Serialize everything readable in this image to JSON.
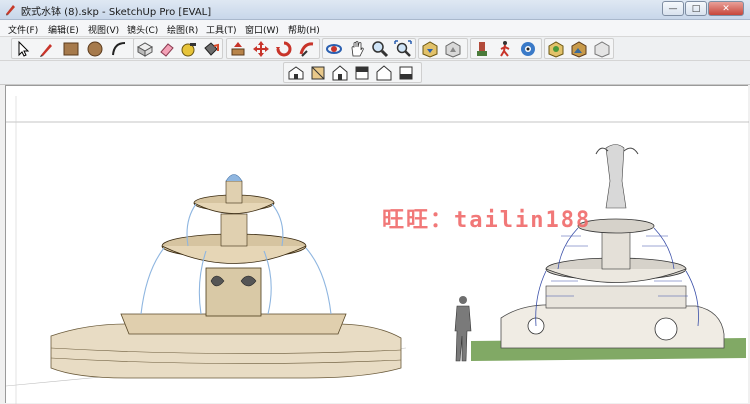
{
  "window": {
    "title": "欧式水钵 (8).skp - SketchUp Pro [EVAL]",
    "buttons": {
      "minimize": "—",
      "maximize": "□",
      "close": "✕"
    }
  },
  "menu": [
    {
      "label": "文件(F)"
    },
    {
      "label": "编辑(E)"
    },
    {
      "label": "视图(V)"
    },
    {
      "label": "镜头(C)"
    },
    {
      "label": "绘图(R)"
    },
    {
      "label": "工具(T)"
    },
    {
      "label": "窗口(W)"
    },
    {
      "label": "帮助(H)"
    }
  ],
  "toolbar_main": [
    {
      "name": "select-icon"
    },
    {
      "name": "pencil-icon"
    },
    {
      "name": "rectangle-icon"
    },
    {
      "name": "circle-icon"
    },
    {
      "name": "arc-icon"
    },
    {
      "name": "make-component-icon"
    },
    {
      "name": "eraser-icon"
    },
    {
      "name": "tape-measure-icon"
    },
    {
      "name": "paint-bucket-icon"
    },
    {
      "name": "push-pull-icon"
    },
    {
      "name": "move-icon"
    },
    {
      "name": "rotate-icon"
    },
    {
      "name": "follow-me-icon"
    },
    {
      "name": "orbit-icon"
    },
    {
      "name": "pan-icon"
    },
    {
      "name": "zoom-icon"
    },
    {
      "name": "zoom-extents-icon"
    },
    {
      "name": "get-models-icon"
    },
    {
      "name": "share-model-icon"
    },
    {
      "name": "position-camera-icon"
    },
    {
      "name": "walk-icon"
    },
    {
      "name": "look-around-icon"
    },
    {
      "name": "add-location-icon"
    },
    {
      "name": "get-photo-texture-icon"
    },
    {
      "name": "share-component-icon"
    }
  ],
  "toolbar_views": [
    {
      "name": "iso-view-icon"
    },
    {
      "name": "top-view-icon"
    },
    {
      "name": "front-view-icon"
    },
    {
      "name": "right-view-icon"
    },
    {
      "name": "back-view-icon"
    },
    {
      "name": "left-view-icon"
    }
  ],
  "viewport": {
    "watermark": "旺旺：tailin188",
    "colors": {
      "stone": "#e8dcc4",
      "water": "#8fb6e0",
      "grass": "#6b9a4a",
      "watermark": "#f06a6a"
    }
  }
}
